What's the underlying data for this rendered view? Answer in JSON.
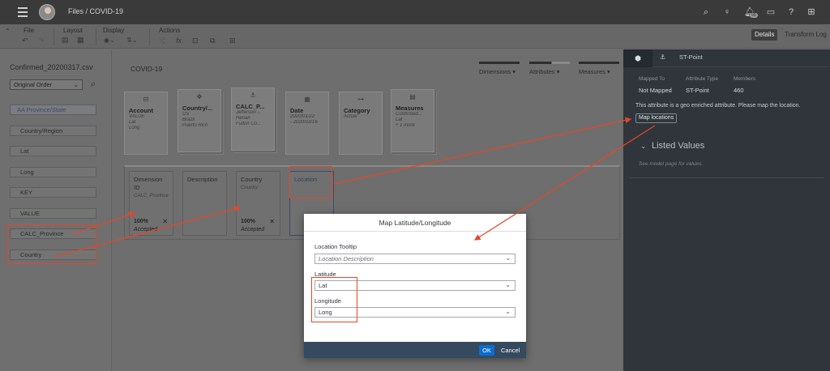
{
  "shell": {
    "breadcrumb": "Files  /  COVID-19",
    "icons": [
      "search-icon",
      "lightbulb-icon",
      "notifications-icon",
      "chat-icon",
      "help-icon",
      "apps-icon"
    ],
    "badge": "99"
  },
  "toolbar": {
    "groups": {
      "file": "File",
      "layout": "Layout",
      "display": "Display",
      "actions": "Actions"
    },
    "details": "Details",
    "transform_log": "Transform Log"
  },
  "left": {
    "file_name": "Confirmed_20200317.csv",
    "sort_value": "Original Order",
    "fields": [
      "AA  Province/State",
      "Country/Region",
      "Lat",
      "Long",
      "KEY",
      "VALUE",
      "CALC_Province",
      "Country"
    ]
  },
  "canvas": {
    "title": "COVID-19",
    "modes": [
      "Dimensions",
      "Attributes",
      "Measures"
    ],
    "cards": [
      {
        "title": "Account",
        "sub": [
          "VALUE",
          "Lat",
          "Long"
        ]
      },
      {
        "title": "Country/...",
        "sub": [
          "US",
          "Brazil",
          "Puerto Rico"
        ]
      },
      {
        "title": "CALC_P...",
        "sub": [
          "Jefferson ...",
          "Henan",
          "Fulton Co..."
        ]
      },
      {
        "title": "Date",
        "sub": [
          "2020/01/22",
          "- 2020/03/16"
        ]
      },
      {
        "title": "Category",
        "sub": [
          "Actual"
        ]
      },
      {
        "title": "Measures",
        "sub": [
          "Confirmed...",
          "Lat",
          "+ 1 more"
        ]
      }
    ],
    "dims": [
      {
        "title": "Dimension ID",
        "sub": "CALC_Province",
        "pct": "100%",
        "status": "Accepted"
      },
      {
        "title": "Description",
        "sub": "",
        "pct": "",
        "status": ""
      },
      {
        "title": "Country",
        "sub": "Country",
        "pct": "100%",
        "status": "Accepted"
      },
      {
        "title": "Location",
        "sub": "",
        "pct": "",
        "status": ""
      }
    ]
  },
  "right": {
    "tab_label": "ST-Point",
    "meta_labels": [
      "Mapped To",
      "Attribute Type",
      "Members"
    ],
    "meta_values": [
      "Not Mapped",
      "ST-Point",
      "460"
    ],
    "note": "This attribute is a geo enriched attribute. Please map the location.",
    "map_button": "Map locations",
    "listed_values": "Listed Values",
    "hint": "See model page for values."
  },
  "dialog": {
    "title": "Map Latitude/Longitude",
    "tooltip_label": "Location Tooltip",
    "tooltip_placeholder": "Location Description",
    "lat_label": "Latitude",
    "lat_value": "Lat",
    "long_label": "Longitude",
    "long_value": "Long",
    "ok": "OK",
    "cancel": "Cancel"
  },
  "colors": {
    "accent": "#0a6ed1",
    "annotation": "#e2472b",
    "footer": "#354a5f"
  }
}
